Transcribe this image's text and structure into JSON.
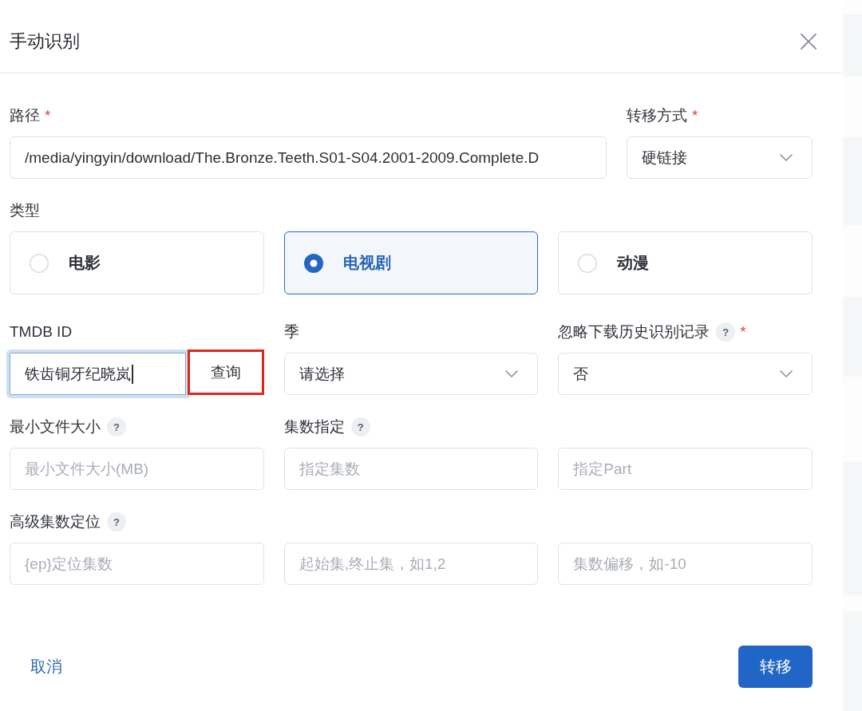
{
  "dialog": {
    "title": "手动识别"
  },
  "path": {
    "label": "路径",
    "required_mark": "*",
    "value": "/media/yingyin/download/The.Bronze.Teeth.S01-S04.2001-2009.Complete.D"
  },
  "transfer_mode": {
    "label": "转移方式",
    "required_mark": "*",
    "value": "硬链接"
  },
  "type": {
    "label": "类型",
    "options": [
      {
        "label": "电影",
        "selected": false
      },
      {
        "label": "电视剧",
        "selected": true
      },
      {
        "label": "动漫",
        "selected": false
      }
    ]
  },
  "tmdb_id": {
    "label": "TMDB ID",
    "value": "铁齿铜牙纪晓岚",
    "focused": true,
    "button": {
      "label": "查询",
      "highlighted": true
    }
  },
  "season": {
    "label": "季",
    "value": "请选择"
  },
  "ignore_history": {
    "label": "忽略下载历史识别记录",
    "help": "?",
    "required_mark": "*",
    "value": "否"
  },
  "min_file_size": {
    "label": "最小文件大小",
    "help": "?",
    "placeholder": "最小文件大小(MB)"
  },
  "episode": {
    "label": "集数指定",
    "help": "?",
    "placeholder": "指定集数"
  },
  "part": {
    "placeholder": "指定Part"
  },
  "advanced": {
    "label": "高级集数定位",
    "help": "?",
    "fields": [
      {
        "placeholder": "{ep}定位集数"
      },
      {
        "placeholder": "起始集,终止集，如1,2"
      },
      {
        "placeholder": "集数偏移，如-10"
      }
    ]
  },
  "footer": {
    "cancel": "取消",
    "submit": "转移"
  }
}
